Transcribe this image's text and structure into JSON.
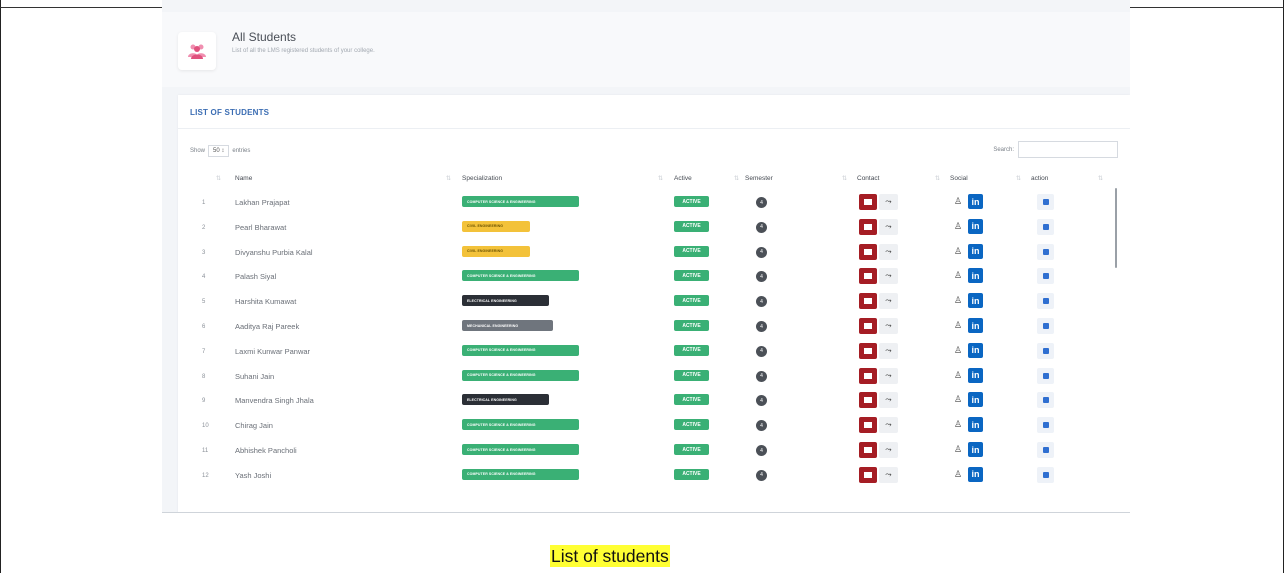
{
  "header": {
    "title": "All Students",
    "subtitle": "List of all the LMS registered students of your college."
  },
  "list": {
    "title": "LIST OF STUDENTS",
    "show_label": "Show",
    "entries_value": "50",
    "entries_label": "entries",
    "search_label": "Search:",
    "search_placeholder": ""
  },
  "columns": [
    "Name",
    "Specialization",
    "Active",
    "Semester",
    "Contact",
    "Social",
    "action"
  ],
  "students": [
    {
      "num": "1",
      "name": "Lakhan Prajapat",
      "spec": "COMPUTER SCIENCE & ENGINEERING",
      "spec_color": "green",
      "active": "ACTIVE",
      "sem": "4"
    },
    {
      "num": "2",
      "name": "Pearl Bharawat",
      "spec": "CIVIL ENGINEERING",
      "spec_color": "yellow",
      "active": "ACTIVE",
      "sem": "4"
    },
    {
      "num": "3",
      "name": "Divyanshu Purbia Kalal",
      "spec": "CIVIL ENGINEERING",
      "spec_color": "yellow",
      "active": "ACTIVE",
      "sem": "4"
    },
    {
      "num": "4",
      "name": "Palash Siyal",
      "spec": "COMPUTER SCIENCE & ENGINEERING",
      "spec_color": "green",
      "active": "ACTIVE",
      "sem": "4"
    },
    {
      "num": "5",
      "name": "Harshita Kumawat",
      "spec": "ELECTRICAL ENGINEERING",
      "spec_color": "dark",
      "active": "ACTIVE",
      "sem": "4"
    },
    {
      "num": "6",
      "name": "Aaditya Raj Pareek",
      "spec": "MECHANICAL ENGINEERING",
      "spec_color": "gray",
      "active": "ACTIVE",
      "sem": "4"
    },
    {
      "num": "7",
      "name": "Laxmi Kunwar Panwar",
      "spec": "COMPUTER SCIENCE & ENGINEERING",
      "spec_color": "green",
      "active": "ACTIVE",
      "sem": "4"
    },
    {
      "num": "8",
      "name": "Suhani Jain",
      "spec": "COMPUTER SCIENCE & ENGINEERING",
      "spec_color": "green",
      "active": "ACTIVE",
      "sem": "4"
    },
    {
      "num": "9",
      "name": "Manvendra Singh Jhala",
      "spec": "ELECTRICAL ENGINEERING",
      "spec_color": "dark",
      "active": "ACTIVE",
      "sem": "4"
    },
    {
      "num": "10",
      "name": "Chirag Jain",
      "spec": "COMPUTER SCIENCE & ENGINEERING",
      "spec_color": "green",
      "active": "ACTIVE",
      "sem": "4"
    },
    {
      "num": "11",
      "name": "Abhishek Pancholi",
      "spec": "COMPUTER SCIENCE & ENGINEERING",
      "spec_color": "green",
      "active": "ACTIVE",
      "sem": "4"
    },
    {
      "num": "12",
      "name": "Yash Joshi",
      "spec": "COMPUTER SCIENCE & ENGINEERING",
      "spec_color": "green",
      "active": "ACTIVE",
      "sem": "4"
    }
  ],
  "icons": {
    "mail": "mail-icon",
    "phone": "phone-icon",
    "github": "github-icon",
    "linkedin": "linkedin-icon",
    "action": "edit-icon",
    "header": "students-group-icon"
  },
  "caption": "List of students",
  "colors": {
    "highlight": "#ffff33",
    "green": "#3ab075",
    "yellow": "#f3c23a",
    "dark": "#2b2f36",
    "gray": "#6f757d",
    "mail": "#a51d24",
    "linkedin": "#0a66c2",
    "title_blue": "#3b6db3"
  }
}
